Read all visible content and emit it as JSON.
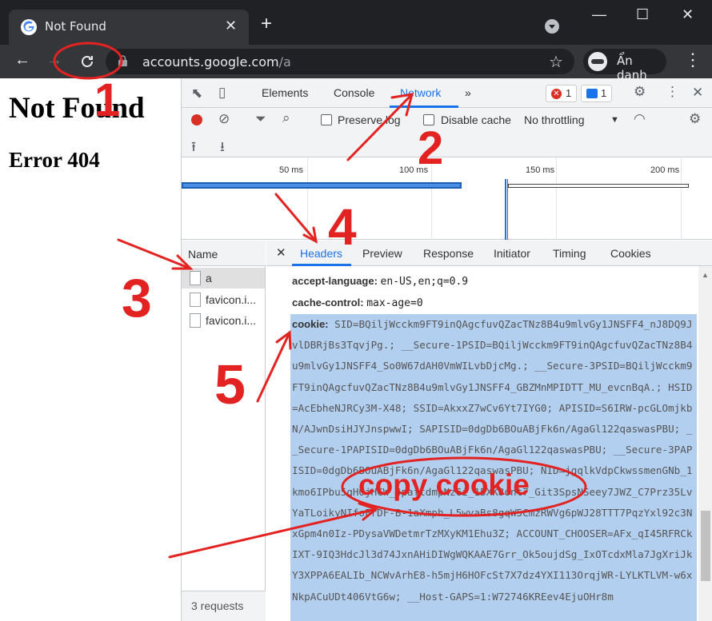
{
  "browser": {
    "tab_title": "Not Found",
    "tab_close": "✕",
    "new_tab": "+",
    "url_domain": "accounts.google.com",
    "url_path": "/a",
    "profile_label": "Ẩn danh",
    "window_controls": {
      "minimize": "—",
      "maximize": "☐",
      "close": "✕"
    },
    "icons": [
      "google-favicon",
      "back-arrow",
      "forward-arrow",
      "reload-icon",
      "lock-icon",
      "star-icon",
      "incognito-icon",
      "kebab-menu",
      "tab-search-icon"
    ]
  },
  "page": {
    "heading": "Not Found",
    "subheading": "Error 404"
  },
  "devtools": {
    "tabs": [
      "Elements",
      "Console",
      "Network"
    ],
    "more_tabs": "»",
    "active_tab": "Network",
    "error_count": "1",
    "message_count": "1",
    "toolbar": {
      "preserve_log": "Preserve log",
      "disable_cache": "Disable cache",
      "throttling": "No throttling"
    },
    "timeline_ticks": [
      "50 ms",
      "100 ms",
      "150 ms",
      "200 ms"
    ],
    "name_header": "Name",
    "requests": [
      "a",
      "favicon.i...",
      "favicon.i..."
    ],
    "status": "3 requests",
    "detail_tabs": [
      "Headers",
      "Preview",
      "Response",
      "Initiator",
      "Timing",
      "Cookies"
    ],
    "active_detail_tab": "Headers",
    "headers": [
      {
        "key": "accept-language:",
        "value": "en-US,en;q=0.9"
      },
      {
        "key": "cache-control:",
        "value": "max-age=0"
      }
    ],
    "cookie_key": "cookie:",
    "cookie_value": "SID=BQiljWcckm9FT9inQAgcfuvQZacTNz8B4u9mlvGy1JNSFF4_nJ8DQ9JvlDBRjBs3TqvjPg.; __Secure-1PSID=BQiljWcckm9FT9inQAgcfuvQZacTNz8B4u9mlvGy1JNSFF4_So0W67dAH0VmWILvbDjcMg.; __Secure-3PSID=BQiljWcckm9FT9inQAgcfuvQZacTNz8B4u9mlvGy1JNSFF4_GBZMnMPIDTT_MU_evcnBqA.; HSID=AcEbheNJRCy3M-X48; SSID=AkxxZ7wCv6Yt7IYG0; APISID=S6IRW-pcGLOmjkbN/AJwnDsiHJYJnspwwI; SAPISID=0dgDb6BOuABjFk6n/AgaGl122qaswasPBU; __Secure-1PAPISID=0dgDb6BOuABjFk6n/AgaGl122qaswasPBU; __Secure-3PAPISID=0dgDb6BOuABjFk6n/AgaGl122qaswasPBU; NID=jgqlkVdpCkwssmenGNb_1kmo6IPbu5qH0jHCW_4paftdmpNz6i_15XK8ont7_Git3SpsNSeey7JWZ_C7Prz35LvYaTLoikyNIfoFrDF-B-1aXmph_L5wvaBs8gqW5CmzRWVg6pWJ28TTT7PqzYxl92c3NxGpm4n0Iz-PDysaVWDetmrTzMXyKM1Ehu3Z; ACCOUNT_CHOOSER=AFx_qI45RFRCkIXT-9IQ3HdcJl3d74JxnAHiDIWgWQKAAE7Grr_Ok5oujdSg_IxOTcdxMla7JgXriJkY3XPPA6EALIb_NCWvArhE8-h5mjH6HOFcSt7X7dz4YXI113OrqjWR-LYLKTLVM-w6xNkpACuUDt406VtG6w; __Host-GAPS=1:W72746KREev4EjuOHr8m"
  },
  "annotations": {
    "steps": [
      "1",
      "2",
      "3",
      "4",
      "5"
    ],
    "callout": "copy cookie",
    "color": "#e32222"
  }
}
